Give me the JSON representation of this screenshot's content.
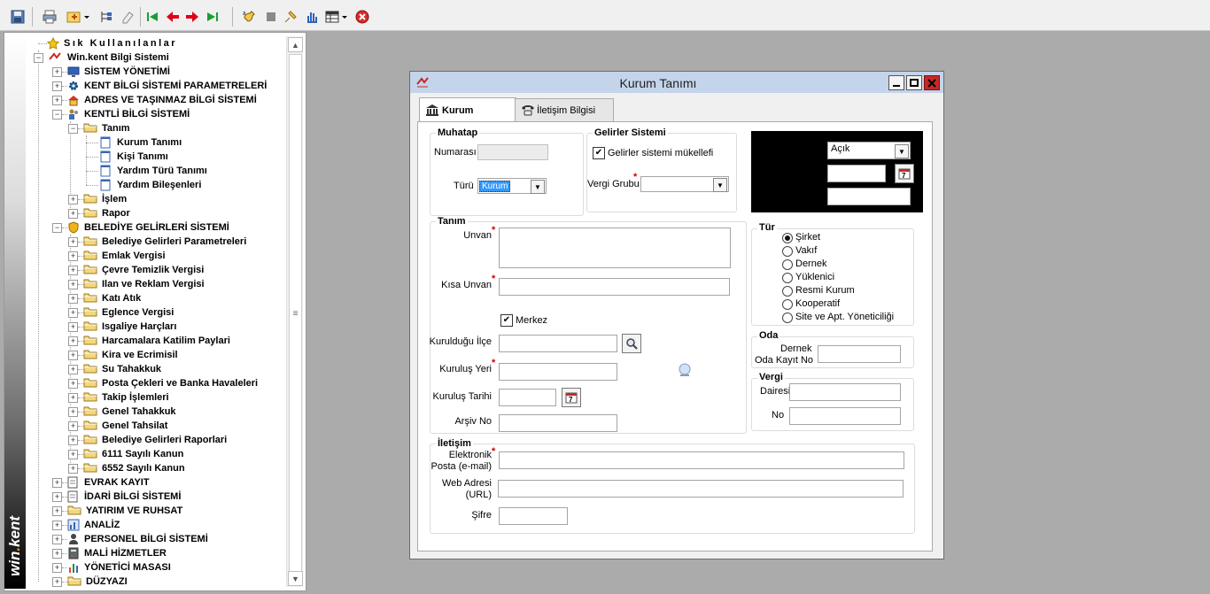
{
  "toolbar": {
    "icons": [
      "save-icon",
      "print-icon",
      "tools-dropdown-icon",
      "tree-icon",
      "eraser-icon",
      "first-record-icon",
      "previous-record-icon",
      "next-record-icon",
      "last-record-icon",
      "hand-icon",
      "stop-icon",
      "pin-icon",
      "hand-select-icon",
      "grid-dropdown-icon",
      "close-red-icon"
    ]
  },
  "brand": "win.kent",
  "tree": {
    "favorites": "Sık Kullanılanlar",
    "root": "Win.kent Bilgi Sistemi",
    "items": [
      {
        "label": "SİSTEM YÖNETİMİ"
      },
      {
        "label": "KENT BİLGİ SİSTEMİ PARAMETRELERİ"
      },
      {
        "label": "ADRES VE TAŞINMAZ BİLGİ SİSTEMİ"
      },
      {
        "label": "KENTLİ BİLGİ SİSTEMİ"
      },
      {
        "label": "Tanım"
      },
      {
        "label": "Kurum Tanımı"
      },
      {
        "label": "Kişi Tanımı"
      },
      {
        "label": "Yardım Türü Tanımı"
      },
      {
        "label": "Yardım Bileşenleri"
      },
      {
        "label": "İşlem"
      },
      {
        "label": "Rapor"
      },
      {
        "label": "BELEDİYE GELİRLERİ SİSTEMİ"
      },
      {
        "label": "Belediye Gelirleri Parametreleri"
      },
      {
        "label": "Emlak Vergisi"
      },
      {
        "label": "Çevre Temizlik Vergisi"
      },
      {
        "label": "Ilan ve Reklam Vergisi"
      },
      {
        "label": "Katı Atık"
      },
      {
        "label": "Eglence Vergisi"
      },
      {
        "label": "Isgaliye Harçları"
      },
      {
        "label": "Harcamalara Katilim Paylari"
      },
      {
        "label": "Kira ve Ecrimisil"
      },
      {
        "label": "Su Tahakkuk"
      },
      {
        "label": "Posta Çekleri ve Banka Havaleleri"
      },
      {
        "label": "Takip İşlemleri"
      },
      {
        "label": "Genel Tahakkuk"
      },
      {
        "label": "Genel Tahsilat"
      },
      {
        "label": "Belediye Gelirleri Raporlari"
      },
      {
        "label": "6111 Sayılı Kanun"
      },
      {
        "label": "6552 Sayılı Kanun"
      },
      {
        "label": "EVRAK KAYIT"
      },
      {
        "label": "İDARİ BİLGİ SİSTEMİ"
      },
      {
        "label": "YATIRIM VE RUHSAT"
      },
      {
        "label": "ANALİZ"
      },
      {
        "label": "PERSONEL BİLGİ SİSTEMİ"
      },
      {
        "label": "MALİ HİZMETLER"
      },
      {
        "label": "YÖNETİCİ MASASI"
      },
      {
        "label": "DÜZYAZI"
      }
    ]
  },
  "dialog": {
    "title": "Kurum Tanımı",
    "tabs": {
      "kurum": "Kurum",
      "iletisim": "İletişim Bilgisi"
    },
    "muhatap": {
      "title": "Muhatap",
      "numarasi_label": "Numarası",
      "numarasi_value": "",
      "turu_label": "Türü",
      "turu_value": "Kurum"
    },
    "gelirler": {
      "title": "Gelirler Sistemi",
      "checkbox_label": "Gelirler sistemi mükellefi",
      "checked": true,
      "vergi_grubu_label": "Vergi Grubu",
      "vergi_grubu_value": ""
    },
    "status": {
      "value": "Açık",
      "date_value": "",
      "extra_value": ""
    },
    "tanim": {
      "title": "Tanım",
      "unvan_label": "Unvan",
      "unvan_value": "",
      "kisa_unvan_label": "Kısa Unvan",
      "kisa_unvan_value": "",
      "merkez_label": "Merkez",
      "merkez_checked": true,
      "kuruldugu_ilce_label": "Kurulduğu İlçe",
      "kuruldugu_ilce_value": "",
      "kurulus_yeri_label": "Kuruluş Yeri",
      "kurulus_yeri_value": "",
      "kurulus_tarihi_label": "Kuruluş Tarihi",
      "kurulus_tarihi_value": "",
      "arsiv_no_label": "Arşiv No",
      "arsiv_no_value": ""
    },
    "tur": {
      "title": "Tür",
      "options": [
        {
          "label": "Şirket",
          "selected": true
        },
        {
          "label": "Vakıf",
          "selected": false
        },
        {
          "label": "Dernek",
          "selected": false
        },
        {
          "label": "Yüklenici",
          "selected": false
        },
        {
          "label": "Resmi Kurum",
          "selected": false
        },
        {
          "label": "Kooperatif",
          "selected": false
        },
        {
          "label": "Site ve Apt. Yöneticiliği",
          "selected": false
        }
      ]
    },
    "oda": {
      "title": "Oda",
      "dernek_label_1": "Dernek",
      "dernek_label_2": "Oda Kayıt No",
      "value": ""
    },
    "vergi": {
      "title": "Vergi",
      "dairesi_label": "Dairesi",
      "dairesi_value": "",
      "no_label": "No",
      "no_value": ""
    },
    "iletisim": {
      "title": "İletişim",
      "email_label_1": "Elektronik",
      "email_label_2": "Posta (e-mail)",
      "email_value": "",
      "web_label_1": "Web Adresi",
      "web_label_2": "(URL)",
      "web_value": "",
      "sifre_label": "Şifre",
      "sifre_value": ""
    }
  },
  "colors": {
    "title_bar": "#c4d4ea",
    "close_red": "#c62828",
    "required": "#cc0000",
    "selection": "#3399ff"
  }
}
